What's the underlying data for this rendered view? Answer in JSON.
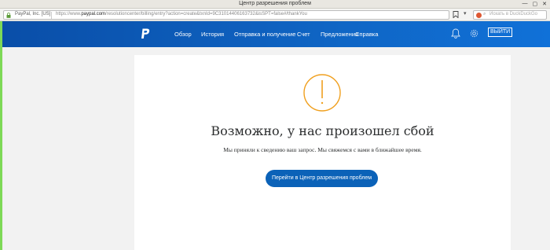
{
  "window": {
    "title": "Центр разрешения проблем",
    "controls": [
      "—",
      "▢",
      "✕"
    ]
  },
  "addressbar": {
    "site_label": "PayPal, Inc. [US]",
    "url_prefix": "https://www.",
    "url_domain": "paypal.com",
    "url_rest": "/resolutioncenter/billing/entry?action=create&txnId=9C31014406163732&isSPT=false#/thankYou",
    "search_placeholder": "Искать в DuckDuckGo",
    "dropdown_glyph": "▾",
    "search_glyph": "⌕"
  },
  "header": {
    "nav": [
      "Обзор",
      "История",
      "Отправка и получение",
      "Счет",
      "Предложения",
      "Справка"
    ],
    "logout_label": "ВЫЙТИ"
  },
  "main": {
    "heading": "Возможно, у нас произошел сбой",
    "message": "Мы приняли к сведению ваш запрос. Мы свяжемся с вами в ближайшее время.",
    "cta_label": "Перейти в Центр разрешения проблем"
  },
  "colors": {
    "header_blue": "#0f65c4",
    "cta_blue": "#0b62b8",
    "error_icon": "#f0a01f",
    "side_strip": "#7ed957"
  },
  "icons": [
    "lock-icon",
    "bookmark-icon",
    "duckduckgo-icon",
    "paypal-logo",
    "bell-icon",
    "gear-icon",
    "error-icon"
  ]
}
